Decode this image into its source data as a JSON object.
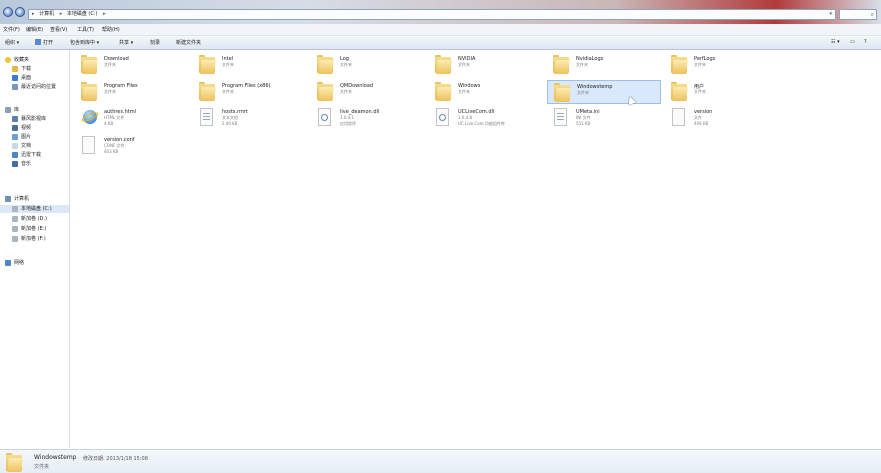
{
  "address": {
    "segments": [
      "计算机",
      "本地磁盘 (C:)"
    ]
  },
  "menu": [
    "文件(F)",
    "编辑(E)",
    "查看(V)",
    "工具(T)",
    "帮助(H)"
  ],
  "toolbar": {
    "organize": "组织 ▾",
    "open": "打开",
    "include": "包含到库中 ▾",
    "share": "共享 ▾",
    "burn": "刻录",
    "new_folder": "新建文件夹"
  },
  "sidebar": {
    "favorites": "收藏夹",
    "downloads": "下载",
    "desktop": "桌面",
    "recent": "最近访问的位置",
    "libraries": "库",
    "videos": "暴风影视库",
    "video": "视频",
    "pictures": "图片",
    "documents": "文档",
    "thunder": "迅雷下载",
    "music": "音乐",
    "computer": "计算机",
    "drive_c": "本地磁盘 (C:)",
    "drive_d": "新加卷 (D:)",
    "drive_e": "新加卷 (E:)",
    "drive_f": "新加卷 (F:)",
    "network": "网络"
  },
  "items": [
    {
      "name": "Download",
      "type": "文件夹",
      "size": ""
    },
    {
      "name": "Intel",
      "type": "文件夹",
      "size": ""
    },
    {
      "name": "Log",
      "type": "文件夹",
      "size": ""
    },
    {
      "name": "NVIDIA",
      "type": "文件夹",
      "size": ""
    },
    {
      "name": "NvidiaLogs",
      "type": "文件夹",
      "size": ""
    },
    {
      "name": "PerfLogs",
      "type": "文件夹",
      "size": ""
    },
    {
      "name": "Program Files",
      "type": "文件夹",
      "size": ""
    },
    {
      "name": "Program Files (x86)",
      "type": "文件夹",
      "size": ""
    },
    {
      "name": "QMDownload",
      "type": "文件夹",
      "size": ""
    },
    {
      "name": "Windows",
      "type": "文件夹",
      "size": ""
    },
    {
      "name": "Windowstemp",
      "type": "文件夹",
      "size": ""
    },
    {
      "name": "用户",
      "type": "文件夹",
      "size": ""
    },
    {
      "name": "authres.html",
      "type": "HTML 文件",
      "size": "4 KB"
    },
    {
      "name": "hosts.rmrt",
      "type": "文本文档",
      "size": "2.40 KB"
    },
    {
      "name": "live_deamon.dll",
      "type": "1.0.0.1",
      "size": "应用程序"
    },
    {
      "name": "UCLiveCom.dll",
      "type": "1.0.4.8",
      "size": "UC Live Com 功能组件库"
    },
    {
      "name": "UMeta.ini",
      "type": "INI 文件",
      "size": "551 KB"
    },
    {
      "name": "version",
      "type": "文件",
      "size": "406 KB"
    },
    {
      "name": "version.conf",
      "type": "CONF 文件",
      "size": "403 KB"
    }
  ],
  "details": {
    "name": "Windowstemp",
    "modified": "修改日期: 2013/1/18 15:08",
    "type": "文件夹"
  }
}
